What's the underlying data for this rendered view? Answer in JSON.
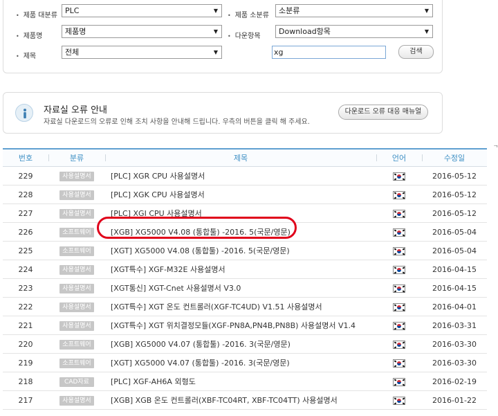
{
  "search": {
    "category_label": "제품 대분류",
    "category_value": "PLC",
    "subcategory_label": "제품 소분류",
    "subcategory_value": "소분류",
    "product_label": "제품명",
    "product_value": "제품명",
    "download_label": "다운항목",
    "download_value": "Download항목",
    "title_label": "제목",
    "title_scope_value": "전체",
    "keyword_value": "xg",
    "search_button": "검색"
  },
  "notice": {
    "title": "자료실 오류 안내",
    "description": "자료실 다운로드의 오류로 인해 조치 사항을 안내해 드립니다. 우측의 버튼을 클릭 해 주세요.",
    "button": "다운로드 오류 대응 매뉴얼"
  },
  "table": {
    "headers": [
      "번호",
      "분류",
      "제목",
      "언어",
      "수정일"
    ],
    "rows": [
      {
        "no": "229",
        "category": "사용설명서",
        "title": "[PLC] XGR CPU 사용설명서",
        "date": "2016-05-12"
      },
      {
        "no": "228",
        "category": "사용설명서",
        "title": "[PLC] XGK CPU 사용설명서",
        "date": "2016-05-12"
      },
      {
        "no": "227",
        "category": "사용설명서",
        "title": "[PLC] XGI CPU 사용설명서",
        "date": "2016-05-12"
      },
      {
        "no": "226",
        "category": "소프트웨어",
        "title": "[XGB] XG5000 V4.08 (통합툴) -2016. 5(국문/영문)",
        "date": "2016-05-04"
      },
      {
        "no": "225",
        "category": "소프트웨어",
        "title": "[XGT] XG5000 V4.08 (통합툴) -2016. 5(국문/영문)",
        "date": "2016-05-04"
      },
      {
        "no": "224",
        "category": "사용설명서",
        "title": "[XGT특수] XGF-M32E 사용설명서",
        "date": "2016-04-15"
      },
      {
        "no": "223",
        "category": "사용설명서",
        "title": "[XGT통신] XGT-Cnet 사용설명서 V3.0",
        "date": "2016-04-15"
      },
      {
        "no": "222",
        "category": "사용설명서",
        "title": "[XGT특수] XGT 온도 컨트롤러(XGF-TC4UD) V1.51 사용설명서",
        "date": "2016-04-01"
      },
      {
        "no": "221",
        "category": "사용설명서",
        "title": "[XGT특수] XGT 위치결정모듈(XGF-PN8A,PN4B,PN8B) 사용설명서 V1.4",
        "date": "2016-03-31"
      },
      {
        "no": "220",
        "category": "소프트웨어",
        "title": "[XGB] XG5000 V4.07 (통합툴) -2016. 3(국문/영문)",
        "date": "2016-03-30"
      },
      {
        "no": "219",
        "category": "소프트웨어",
        "title": "[XGT] XG5000 V4.07 (통합툴) -2016. 3(국문/영문)",
        "date": "2016-03-30"
      },
      {
        "no": "218",
        "category": "CAD자료",
        "title": "[PLC] XGF-AH6A 외형도",
        "date": "2016-02-19"
      },
      {
        "no": "217",
        "category": "사용설명서",
        "title": "[XGB] XGB 온도 컨트롤러(XBF-TC04RT, XBF-TC04TT) 사용설명서",
        "date": "2016-01-22"
      }
    ],
    "language_icon": "korean-flag-icon"
  },
  "colors": {
    "header_text": "#3d8fc4",
    "highlight": "#e0001a",
    "badge": "#c7c7c7"
  }
}
